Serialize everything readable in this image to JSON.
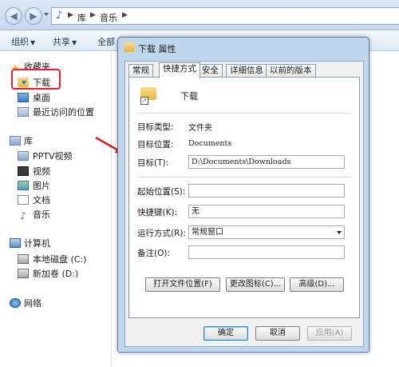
{
  "explorer": {
    "breadcrumb": [
      "库",
      "音乐"
    ],
    "toolbar": {
      "organize": "组织",
      "share": "共享",
      "all": "全部"
    },
    "sidebar": {
      "favorites_head": "收藏夹",
      "favorites": [
        "下载",
        "桌面",
        "最近访问的位置"
      ],
      "libraries_head": "库",
      "libraries": [
        "PPTV视频",
        "视频",
        "图片",
        "文档",
        "音乐"
      ],
      "computer_head": "计算机",
      "drives": [
        "本地磁盘 (C:)",
        "新加卷 (D:)"
      ],
      "network_head": "网络"
    }
  },
  "dialog": {
    "title": "下载 属性",
    "tabs": [
      "常规",
      "快捷方式",
      "安全",
      "详细信息",
      "以前的版本"
    ],
    "active_tab_index": 1,
    "name": "下载",
    "target_type_label": "目标类型:",
    "target_type": "文件夹",
    "target_location_label": "目标位置:",
    "target_location": "Documents",
    "target_label": "目标(T):",
    "target": "D:\\Documents\\Downloads",
    "start_in_label": "起始位置(S):",
    "start_in": "",
    "shortcut_key_label": "快捷键(K):",
    "shortcut_key": "无",
    "run_label": "运行方式(R):",
    "run": "常规窗口",
    "comment_label": "备注(O):",
    "comment": "",
    "buttons": {
      "open_location": "打开文件位置(F)",
      "change_icon": "更改图标(C)...",
      "advanced": "高级(D)..."
    },
    "footer": {
      "ok": "确定",
      "cancel": "取消",
      "apply": "应用(A)"
    }
  },
  "colors": {
    "highlight_border": "#e02424",
    "arrow": "#d11f1f"
  }
}
